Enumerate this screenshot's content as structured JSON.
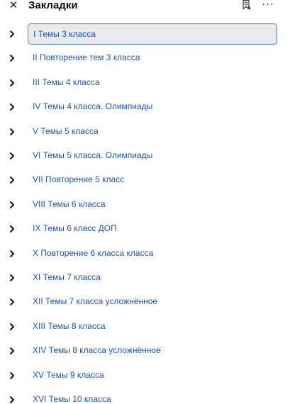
{
  "header": {
    "close_icon": "close-icon",
    "title": "Закладки",
    "bookmark_icon": "bookmark-search-icon",
    "more_icon": "more-horizontal-icon",
    "more_label": "···"
  },
  "colors": {
    "link": "#1a56b8",
    "selected_bg": "#e9eaee",
    "selected_border": "#4d7ed8"
  },
  "bookmarks": {
    "selected_index": 0,
    "items": [
      {
        "label": "I Темы 3 класса"
      },
      {
        "label": "II Повторение тем 3 класса"
      },
      {
        "label": "III Темы 4 класса"
      },
      {
        "label": "IV Темы 4 класса. Олимпиады"
      },
      {
        "label": "V Темы 5 класса"
      },
      {
        "label": "VI Темы 5 класса. Олимпиады"
      },
      {
        "label": "VII Повторение 5 класс"
      },
      {
        "label": "VIII Темы 6 класса"
      },
      {
        "label": "IX Темы 6 класс ДОП"
      },
      {
        "label": "X Повторение 6 класса класса"
      },
      {
        "label": "XI Темы 7 класса"
      },
      {
        "label": "XII Темы 7 класса усложнённое"
      },
      {
        "label": "XIII Темы 8 класса"
      },
      {
        "label": "XIV Темы 8 класса усложнённое"
      },
      {
        "label": "XV Темы 9 класса"
      },
      {
        "label": "XVI Темы 10 класса"
      }
    ]
  }
}
